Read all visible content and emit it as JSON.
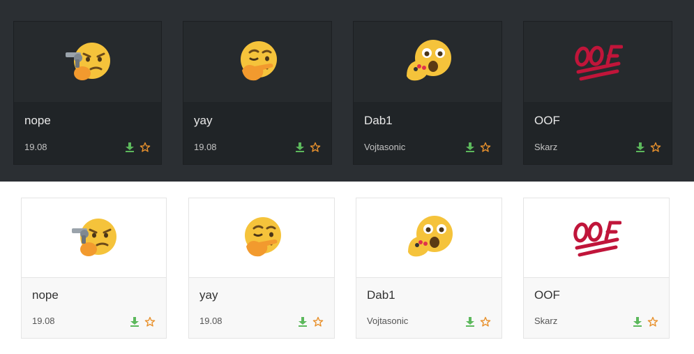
{
  "colors": {
    "download": "#5cb85c",
    "star": "#e8912d",
    "dark_bg": "#2b2f33",
    "dark_card": "#202427",
    "light_card": "#f8f8f8"
  },
  "dark_cards": [
    {
      "name": "nope",
      "meta": "19.08",
      "emoji": "thinking-gun-emoji"
    },
    {
      "name": "yay",
      "meta": "19.08",
      "emoji": "wink-thinking-emoji"
    },
    {
      "name": "Dab1",
      "meta": "Vojtasonic",
      "emoji": "surprised-spinner-emoji"
    },
    {
      "name": "OOF",
      "meta": "Skarz",
      "emoji": "oof-text-emoji"
    }
  ],
  "light_cards": [
    {
      "name": "nope",
      "meta": "19.08",
      "emoji": "thinking-gun-emoji"
    },
    {
      "name": "yay",
      "meta": "19.08",
      "emoji": "wink-thinking-emoji"
    },
    {
      "name": "Dab1",
      "meta": "Vojtasonic",
      "emoji": "surprised-spinner-emoji"
    },
    {
      "name": "OOF",
      "meta": "Skarz",
      "emoji": "oof-text-emoji"
    }
  ]
}
